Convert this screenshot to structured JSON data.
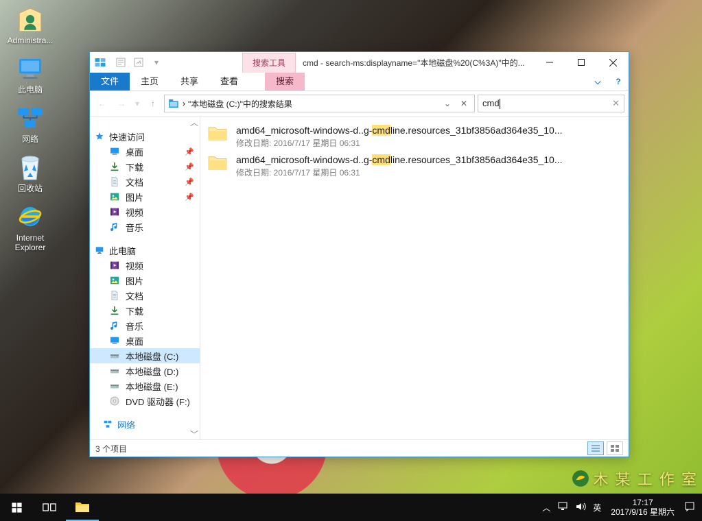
{
  "desktop": {
    "icons": [
      {
        "name": "administrator-icon",
        "label": "Administra..."
      },
      {
        "name": "this-pc-icon",
        "label": "此电脑"
      },
      {
        "name": "network-icon",
        "label": "网络"
      },
      {
        "name": "recycle-bin-icon",
        "label": "回收站"
      },
      {
        "name": "internet-explorer-icon",
        "label": "Internet\nExplorer"
      }
    ]
  },
  "window": {
    "search_tools_tab": "搜索工具",
    "title": "cmd - search-ms:displayname=\"本地磁盘%20(C%3A)\"中的...",
    "ribbon": {
      "file": "文件",
      "home": "主页",
      "share": "共享",
      "view": "查看",
      "search": "搜索"
    },
    "address": {
      "crumb": "\"本地磁盘 (C:)\"中的搜索结果",
      "separator": "›"
    },
    "search_value": "cmd",
    "status": "3 个项目"
  },
  "nav": {
    "quick": "快速访问",
    "quick_items": [
      {
        "icon": "desktop-icon",
        "label": "桌面",
        "pin": true
      },
      {
        "icon": "downloads-icon",
        "label": "下载",
        "pin": true
      },
      {
        "icon": "documents-icon",
        "label": "文档",
        "pin": true
      },
      {
        "icon": "pictures-icon",
        "label": "图片",
        "pin": true
      },
      {
        "icon": "videos-icon",
        "label": "视频"
      },
      {
        "icon": "music-icon",
        "label": "音乐"
      }
    ],
    "thispc": "此电脑",
    "pc_items": [
      {
        "icon": "videos-icon",
        "label": "视频"
      },
      {
        "icon": "pictures-icon",
        "label": "图片"
      },
      {
        "icon": "documents-icon",
        "label": "文档"
      },
      {
        "icon": "downloads-icon",
        "label": "下载"
      },
      {
        "icon": "music-icon",
        "label": "音乐"
      },
      {
        "icon": "desktop-icon",
        "label": "桌面"
      },
      {
        "icon": "drive-icon",
        "label": "本地磁盘 (C:)",
        "selected": true
      },
      {
        "icon": "drive-icon",
        "label": "本地磁盘 (D:)"
      },
      {
        "icon": "drive-icon",
        "label": "本地磁盘 (E:)"
      },
      {
        "icon": "dvd-icon",
        "label": "DVD 驱动器 (F:)"
      }
    ],
    "network": "网络"
  },
  "results": [
    {
      "name_pre": "amd64_microsoft-windows-d..g-",
      "name_hl": "cmd",
      "name_post": "line.resources_31bf3856ad364e35_10...",
      "meta_label": "修改日期:",
      "meta_value": "2016/7/17 星期日 06:31"
    },
    {
      "name_pre": "amd64_microsoft-windows-d..g-",
      "name_hl": "cmd",
      "name_post": "line.resources_31bf3856ad364e35_10...",
      "meta_label": "修改日期:",
      "meta_value": "2016/7/17 星期日 06:31"
    }
  ],
  "taskbar": {
    "ime": "英",
    "time": "17:17",
    "date": "2017/9/16 星期六"
  },
  "watermark": "木 某 工 作 室"
}
